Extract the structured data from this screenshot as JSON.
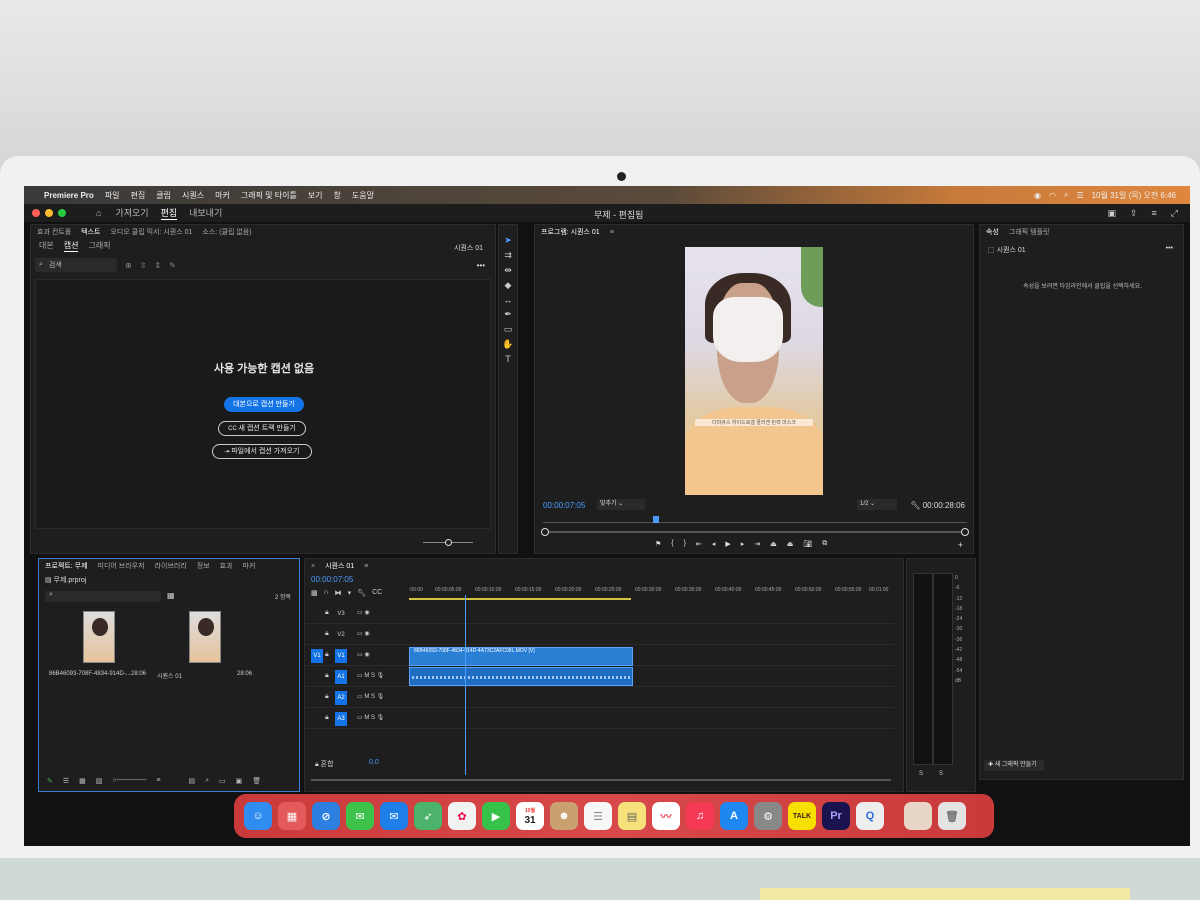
{
  "menubar": {
    "app": "Premiere Pro",
    "items": [
      "파일",
      "편집",
      "클립",
      "시퀀스",
      "마커",
      "그래픽 및 타이틀",
      "보기",
      "창",
      "도움말"
    ],
    "clock": "10월 31일 (목) 오전 6:46"
  },
  "header": {
    "tabs": [
      "가져오기",
      "편집",
      "내보내기"
    ],
    "active_tab": "편집",
    "title": "무제 - 편집됨"
  },
  "text_panel": {
    "panel_tabs": [
      "효과 컨트롤",
      "텍스트",
      "오디오 클립 믹서: 시퀀스 01",
      "소스: (클립 없음)"
    ],
    "subtabs": [
      "대본",
      "캡션",
      "그래픽"
    ],
    "active_subtab": "캡션",
    "sequence": "시퀀스 01",
    "search_placeholder": "검색",
    "empty_title": "사용 가능한 캡션 없음",
    "btn_transcribe": "대본으로 캡션 만들기",
    "btn_new_track": "새 캡션 트랙 만들기",
    "btn_import": "파일에서 캡션 가져오기"
  },
  "program": {
    "title": "프로그램: 시퀀스 01",
    "timecode_current": "00:00:07:05",
    "fit": "맞추기",
    "resolution": "1/2",
    "timecode_duration": "00:00:28:06",
    "video_caption": "더마큐스 하이드로겔 콜라겐 탄력 마스크"
  },
  "properties": {
    "tabs": [
      "속성",
      "그래픽 템플릿"
    ],
    "sequence": "시퀀스 01",
    "hint": "속성을 보려면 타임라인에서 클립을 선택하세요.",
    "new_graphic": "새 그래픽 만들기"
  },
  "project": {
    "tabs": [
      "프로젝트: 무제",
      "미디어 브라우저",
      "라이브러리",
      "정보",
      "효과",
      "마커"
    ],
    "file": "무제.prproj",
    "count": "2 항목",
    "items": [
      {
        "name": "86B46093-708F-4834-914D-...",
        "duration": "28:06"
      },
      {
        "name": "시퀀스 01",
        "duration": "28:06"
      }
    ]
  },
  "timeline": {
    "title": "시퀀스 01",
    "timecode": "00:00:07:05",
    "ruler": [
      ":00:00",
      "00:00:05:00",
      "00:00:10:00",
      "00:00:15:00",
      "00:00:20:00",
      "00:00:25:00",
      "00:00:30:00",
      "00:00:35:00",
      "00:00:40:00",
      "00:00:45:00",
      "00:00:50:00",
      "00:00:55:00",
      "00:01:00"
    ],
    "tracks": [
      "V3",
      "V2",
      "V1",
      "A1",
      "A2",
      "A3"
    ],
    "mix_label": "혼합",
    "mix_value": "0.0",
    "clip_name": "86B46093-708F-4834-914D-4A73C2AFC08L.MOV [V]"
  },
  "meters": {
    "scale": [
      "0",
      "-6",
      "-12",
      "-18",
      "-24",
      "-30",
      "-36",
      "-42",
      "-48",
      "-54",
      "dB"
    ],
    "labels": [
      "S",
      "S"
    ]
  },
  "dock": {
    "calendar_day": "31",
    "calendar_month": "10월",
    "talk": "TALK",
    "pr": "Pr"
  }
}
